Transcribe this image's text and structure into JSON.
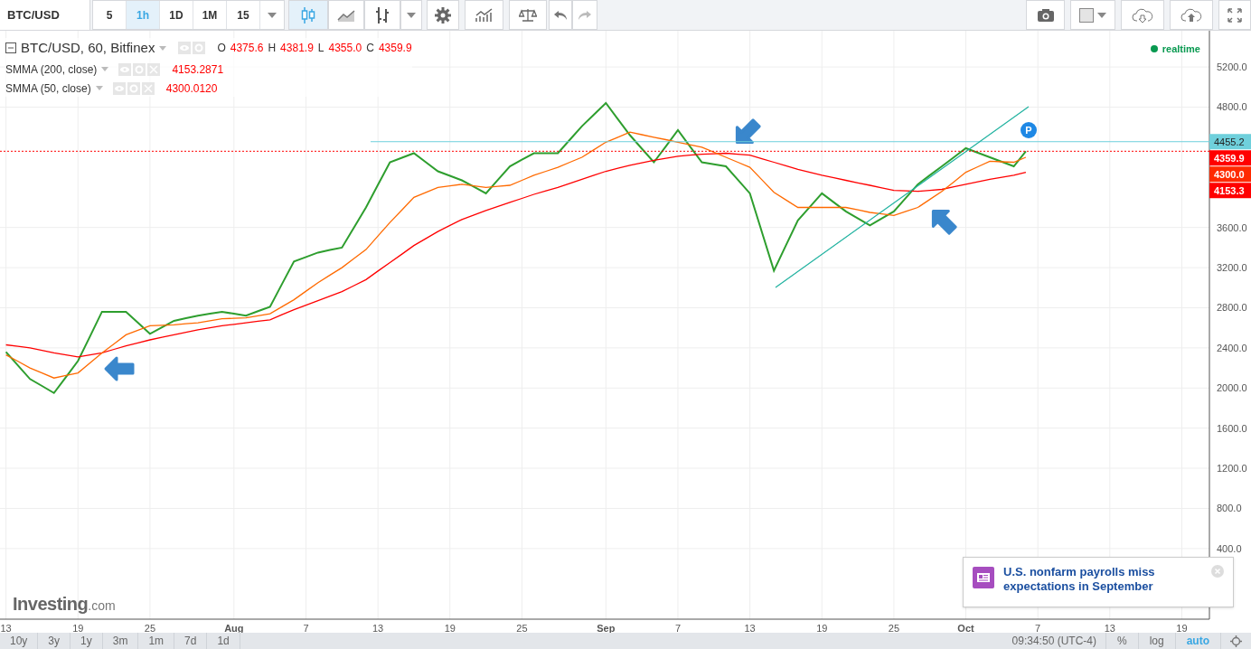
{
  "toolbar": {
    "symbol": "BTC/USD",
    "intervals": [
      {
        "label": "5",
        "selected": false
      },
      {
        "label": "1h",
        "selected": true
      },
      {
        "label": "1D",
        "selected": false
      },
      {
        "label": "1M",
        "selected": false
      },
      {
        "label": "15",
        "selected": false
      }
    ]
  },
  "legend": {
    "title": "BTC/USD, 60, Bitfinex",
    "ohlc": [
      {
        "key": "O",
        "value": "4375.6"
      },
      {
        "key": "H",
        "value": "4381.9"
      },
      {
        "key": "L",
        "value": "4355.0"
      },
      {
        "key": "C",
        "value": "4359.9"
      }
    ],
    "indicators": [
      {
        "name": "SMMA (200, close)",
        "value": "4153.2871"
      },
      {
        "name": "SMMA (50, close)",
        "value": "4300.0120"
      }
    ]
  },
  "status": {
    "label": "realtime"
  },
  "chart_data": {
    "type": "line",
    "categories": [
      "13",
      null,
      null,
      null,
      null,
      null,
      "19",
      null,
      null,
      null,
      null,
      null,
      "25",
      null,
      null,
      null,
      null,
      null,
      null,
      "Aug",
      null,
      null,
      null,
      null,
      null,
      "7",
      null,
      null,
      null,
      null,
      null,
      "13",
      null,
      null,
      null,
      null,
      null,
      "19",
      null,
      null,
      null,
      null,
      null,
      "25",
      null,
      null,
      null,
      null,
      null,
      null,
      "Sep",
      null,
      null,
      null,
      null,
      null,
      "7",
      null,
      null,
      null,
      null,
      null,
      "13",
      null,
      null,
      null,
      null,
      null,
      "19",
      null,
      null,
      null,
      null,
      null,
      "25",
      null,
      null,
      null,
      null,
      null,
      "Oct",
      null,
      null,
      null,
      null,
      null,
      "7",
      null,
      null,
      null,
      null,
      null,
      "13",
      null,
      null,
      null,
      null,
      null,
      "19",
      null,
      null
    ],
    "series": [
      {
        "color": "#2e9e2e",
        "values": [
          2360,
          2225,
          2090,
          2020,
          1950,
          2110,
          2270,
          2515,
          2760,
          2760,
          2760,
          2650,
          2540,
          2605,
          2670,
          2695,
          2720,
          2740,
          2760,
          2740,
          2720,
          2765,
          2810,
          3035,
          3260,
          3305,
          3350,
          3375,
          3400,
          3600,
          3800,
          4025,
          4250,
          4295,
          4340,
          4250,
          4160,
          4115,
          4070,
          4005,
          3940,
          4075,
          4210,
          4275,
          4340,
          4340,
          4340,
          4475,
          4610,
          4725,
          4840,
          4680,
          4520,
          4385,
          4250,
          4410,
          4570,
          4410,
          4250,
          4230,
          4210,
          4075,
          3940,
          3555,
          3170,
          3420,
          3670,
          3805,
          3940,
          3850,
          3760,
          3690,
          3620,
          3690,
          3760,
          3895,
          4030,
          4120,
          4210,
          4300,
          4390,
          4345,
          4300,
          4255,
          4210,
          4360,
          null,
          null,
          null,
          null,
          null,
          null,
          null,
          null,
          null,
          null,
          null,
          null,
          null,
          null,
          null
        ]
      },
      {
        "color": "#ff0000",
        "values": [
          2430,
          2415,
          2400,
          2375,
          2350,
          2330,
          2310,
          2330,
          2350,
          2385,
          2420,
          2450,
          2480,
          2505,
          2530,
          2555,
          2580,
          2600,
          2620,
          2635,
          2650,
          2665,
          2680,
          2730,
          2780,
          2825,
          2870,
          2915,
          2960,
          3020,
          3080,
          3165,
          3250,
          3335,
          3420,
          3490,
          3560,
          3620,
          3680,
          3725,
          3770,
          3810,
          3850,
          3890,
          3930,
          3965,
          4000,
          4040,
          4080,
          4120,
          4160,
          4190,
          4220,
          4245,
          4270,
          4290,
          4310,
          4320,
          4330,
          4335,
          4340,
          4330,
          4320,
          4285,
          4250,
          4215,
          4180,
          4150,
          4120,
          4095,
          4070,
          4045,
          4020,
          3995,
          3970,
          3965,
          3960,
          3970,
          3980,
          4005,
          4030,
          4055,
          4080,
          4100,
          4120,
          4150,
          null,
          null,
          null,
          null,
          null,
          null,
          null,
          null,
          null,
          null,
          null,
          null,
          null,
          null,
          null
        ]
      },
      {
        "color": "#ff6a00",
        "values": [
          2330,
          2265,
          2200,
          2150,
          2100,
          2125,
          2150,
          2250,
          2350,
          2440,
          2530,
          2575,
          2620,
          2625,
          2630,
          2640,
          2650,
          2670,
          2690,
          2695,
          2700,
          2720,
          2740,
          2810,
          2880,
          2965,
          3050,
          3125,
          3200,
          3290,
          3380,
          3515,
          3650,
          3775,
          3900,
          3950,
          4000,
          4015,
          4030,
          4015,
          4000,
          4010,
          4020,
          4070,
          4120,
          4160,
          4200,
          4250,
          4300,
          4375,
          4450,
          4500,
          4550,
          4525,
          4500,
          4475,
          4450,
          4425,
          4400,
          4350,
          4300,
          4250,
          4200,
          4075,
          3950,
          3875,
          3800,
          3800,
          3800,
          3800,
          3800,
          3775,
          3750,
          3735,
          3720,
          3760,
          3800,
          3880,
          3960,
          4055,
          4150,
          4205,
          4260,
          4255,
          4250,
          4300,
          null,
          null,
          null,
          null,
          null,
          null,
          null,
          null,
          null,
          null,
          null,
          null,
          null,
          null,
          null
        ]
      }
    ],
    "ylim": [
      -304,
      5561
    ],
    "grid": true,
    "yticks": [
      {
        "value": 400,
        "label": "400.0"
      },
      {
        "value": 800,
        "label": "800.0"
      },
      {
        "value": 1200,
        "label": "1200.0"
      },
      {
        "value": 1600,
        "label": "1600.0"
      },
      {
        "value": 2000,
        "label": "2000.0"
      },
      {
        "value": 2400,
        "label": "2400.0"
      },
      {
        "value": 2800,
        "label": "2800.0"
      },
      {
        "value": 3200,
        "label": "3200.0"
      },
      {
        "value": 3600,
        "label": "3600.0"
      },
      {
        "value": 4800,
        "label": "4800.0"
      },
      {
        "value": 5200,
        "label": "5200.0"
      }
    ]
  },
  "price_tags": [
    {
      "kind": "drawing",
      "value": "4455.2",
      "color": "#6fd0dc"
    },
    {
      "kind": "last",
      "value": "4359.9",
      "color": "#ff0000"
    },
    {
      "kind": "indicator",
      "value": "4300.0",
      "color": "#ff2a00"
    },
    {
      "kind": "indicator",
      "value": "4153.3",
      "color": "#ff0000"
    }
  ],
  "marker": {
    "label": "P"
  },
  "logo": {
    "name": "Investing",
    "suffix": ".com"
  },
  "notification": {
    "text": "U.S. nonfarm payrolls miss expectations in September"
  },
  "bottom_bar": {
    "ranges": [
      "10y",
      "3y",
      "1y",
      "3m",
      "1m",
      "7d",
      "1d"
    ],
    "time": "09:34:50 (UTC-4)",
    "scale_options": [
      {
        "label": "%",
        "selected": false
      },
      {
        "label": "log",
        "selected": false
      },
      {
        "label": "auto",
        "selected": true
      }
    ]
  }
}
